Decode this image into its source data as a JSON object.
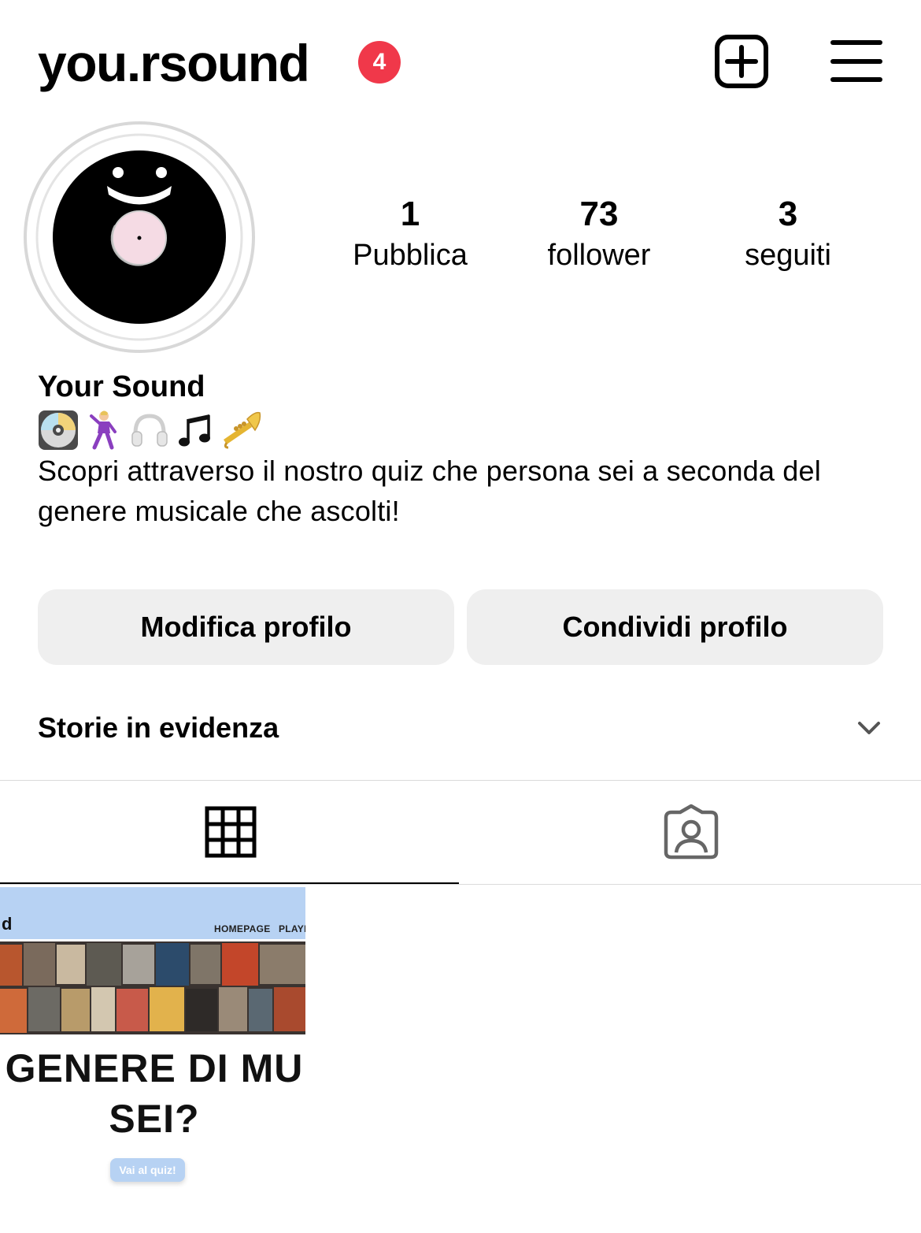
{
  "header": {
    "username": "you.rsound",
    "notification_count": "4",
    "icons": {
      "create": "plus-square-icon",
      "menu": "hamburger-menu-icon"
    }
  },
  "profile": {
    "avatar": "vinyl-record-smile-avatar",
    "stats": [
      {
        "value": "1",
        "label": "Pubblica"
      },
      {
        "value": "73",
        "label": "follower"
      },
      {
        "value": "3",
        "label": "seguiti"
      }
    ],
    "full_name": "Your Sound",
    "emojis": [
      "dvd-emoji",
      "dancer-emoji",
      "headphones-emoji",
      "music-notes-emoji",
      "trumpet-emoji"
    ],
    "bio": "Scopri attraverso il nostro quiz che persona sei a seconda del genere musicale che ascolti!"
  },
  "actions": {
    "edit_profile": "Modifica profilo",
    "share_profile": "Condividi profilo"
  },
  "highlights": {
    "label": "Storie in evidenza",
    "collapsed": true
  },
  "tabs": {
    "active": "grid",
    "items": [
      "grid-icon",
      "tagged-user-icon"
    ]
  },
  "posts": [
    {
      "logo_fragment": "d",
      "nav_links": [
        "HOMEPAGE",
        "PLAYL"
      ],
      "headline_line1": "GENERE DI MU",
      "headline_line2": "SEI?",
      "cta": "Vai al quiz!"
    }
  ],
  "colors": {
    "badge": "#f0384a",
    "button_bg": "#efefef",
    "post_nav": "#b7d2f3"
  }
}
